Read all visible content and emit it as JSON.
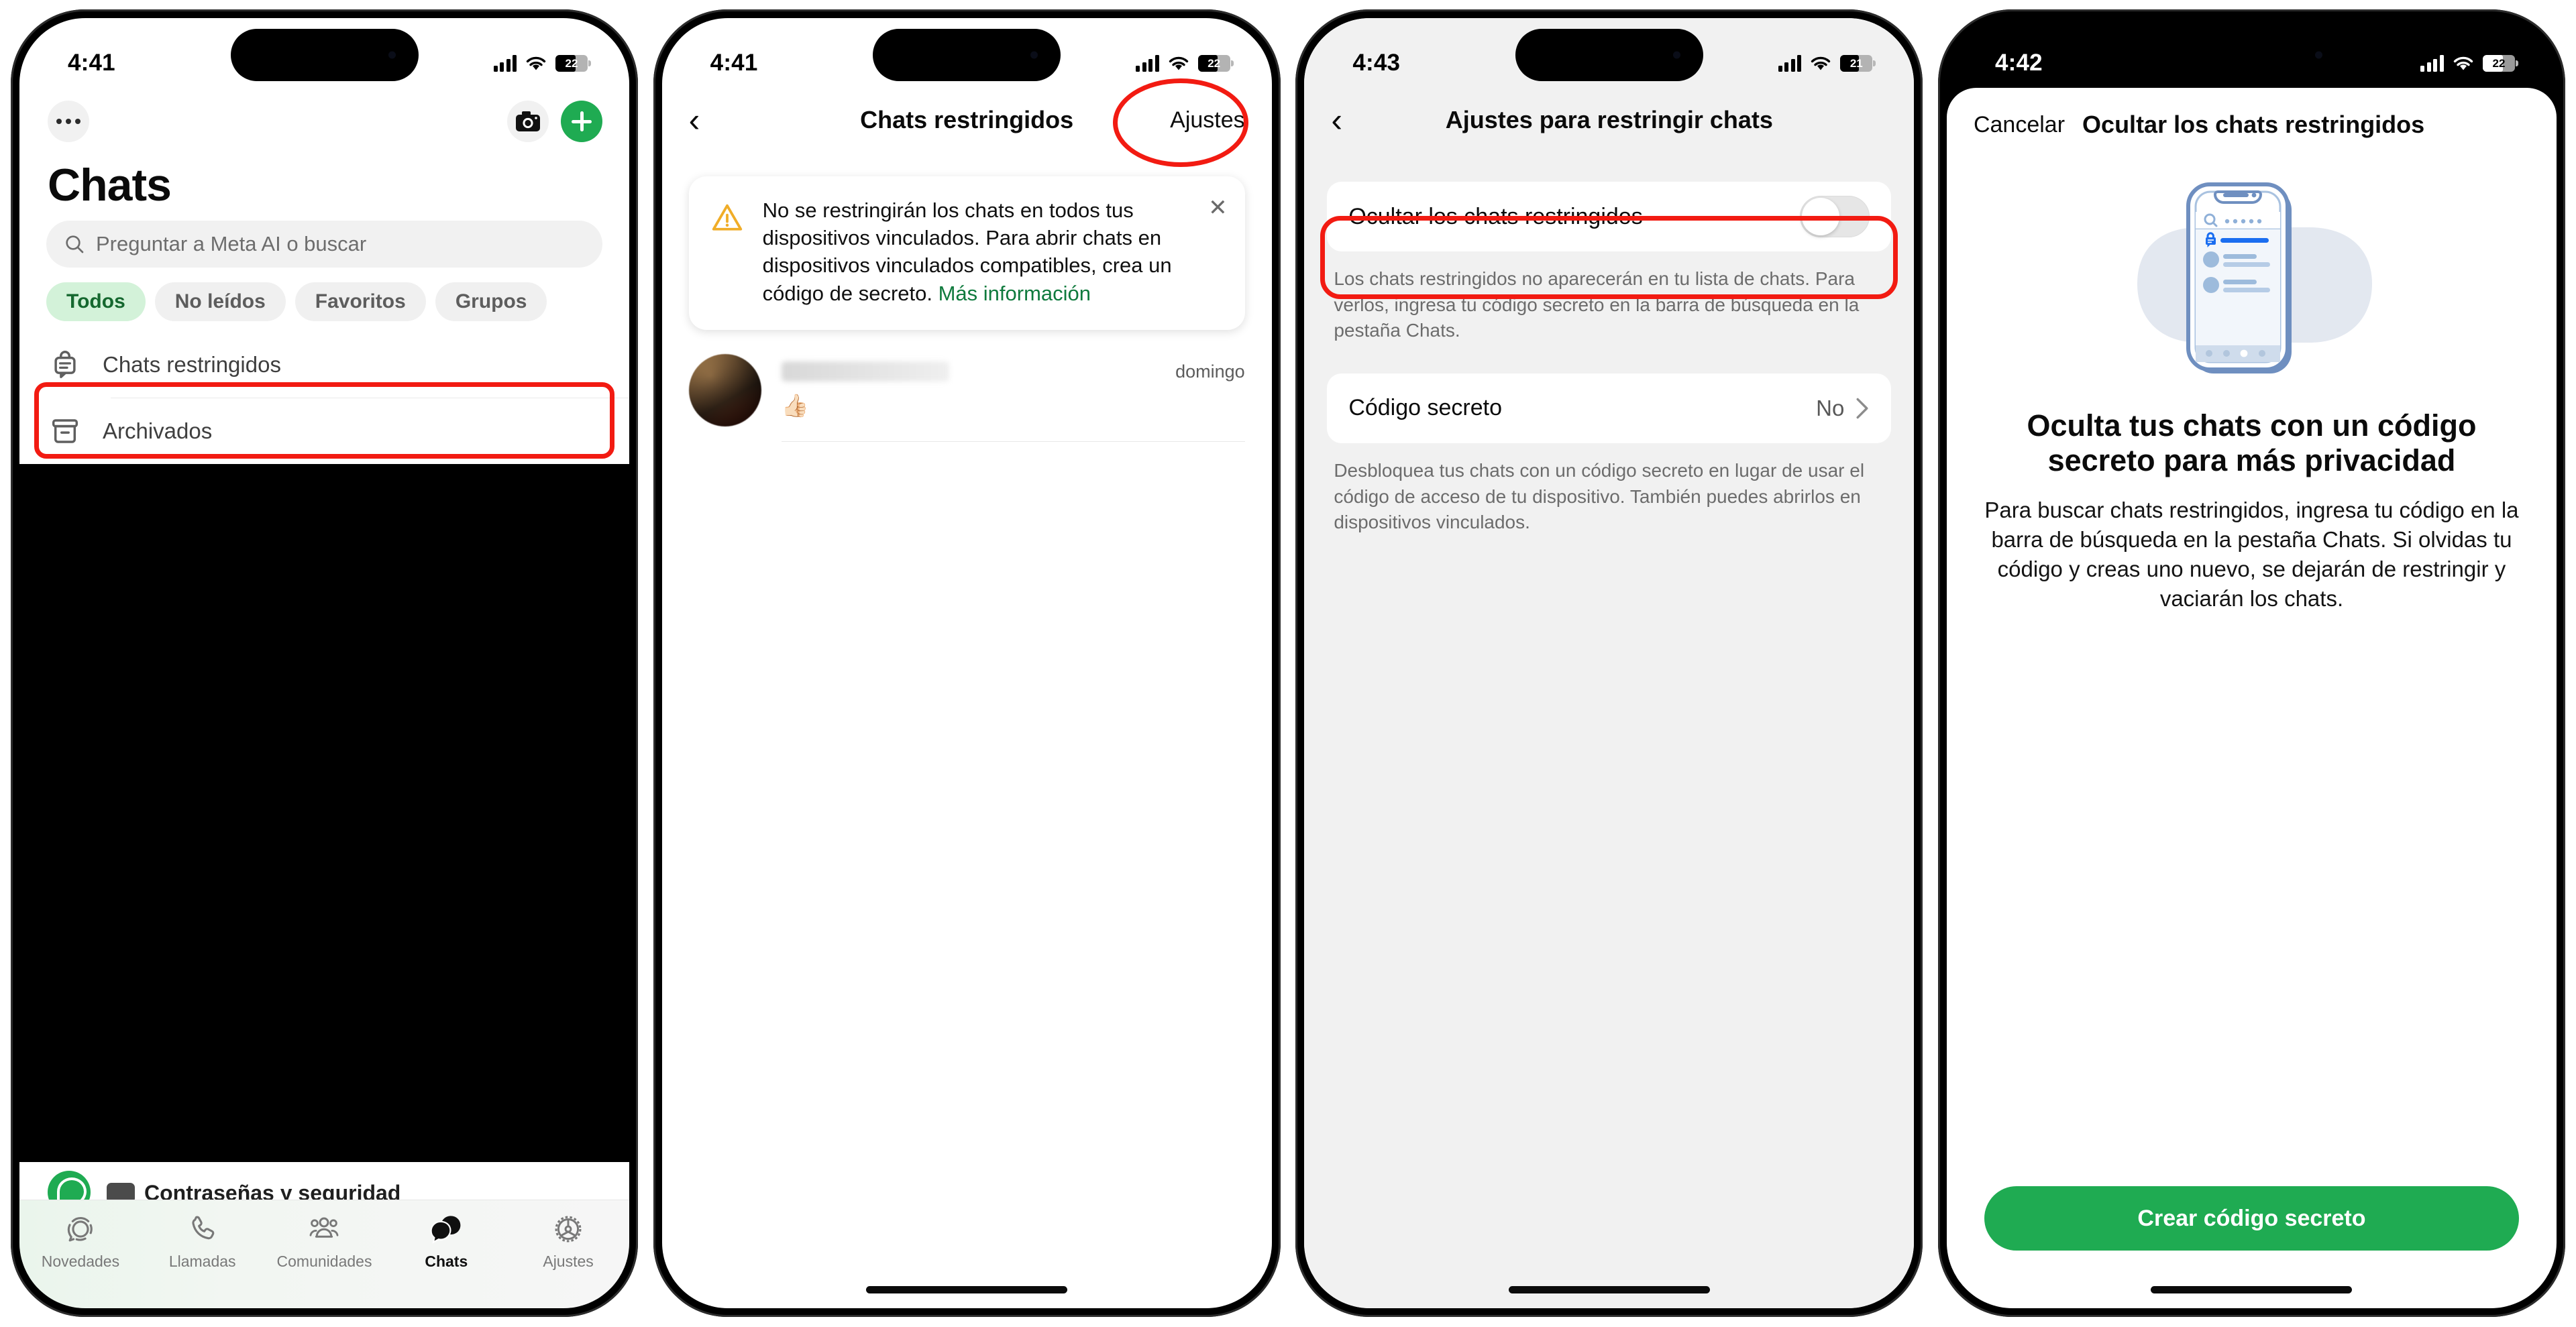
{
  "phones": [
    {
      "status": {
        "time": "4:41",
        "battery": "22"
      },
      "screen": "chats-list",
      "topbar": {
        "menu_icon": "more-dots-icon",
        "camera_icon": "camera-icon",
        "new_chat_icon": "plus-icon"
      },
      "page_title": "Chats",
      "search": {
        "placeholder": "Preguntar a Meta AI o buscar",
        "icon": "search-icon"
      },
      "filters": [
        {
          "label": "Todos",
          "active": true
        },
        {
          "label": "No leídos",
          "active": false
        },
        {
          "label": "Favoritos",
          "active": false
        },
        {
          "label": "Grupos",
          "active": false
        }
      ],
      "rows": [
        {
          "label": "Chats restringidos",
          "icon": "locked-chat-icon",
          "highlighted": true
        },
        {
          "label": "Archivados",
          "icon": "archive-box-icon",
          "highlighted": false
        }
      ],
      "partial_row": {
        "text": "Contraseñas y seguridad",
        "icon": "whatsapp-avatar-icon"
      },
      "tabs": [
        {
          "label": "Novedades",
          "icon": "status-ring-icon",
          "active": false
        },
        {
          "label": "Llamadas",
          "icon": "phone-icon",
          "active": false
        },
        {
          "label": "Comunidades",
          "icon": "communities-icon",
          "active": false
        },
        {
          "label": "Chats",
          "icon": "chat-bubbles-icon",
          "active": true
        },
        {
          "label": "Ajustes",
          "icon": "gear-icon",
          "active": false
        }
      ]
    },
    {
      "status": {
        "time": "4:41",
        "battery": "22"
      },
      "screen": "locked-chats",
      "nav": {
        "back_icon": "chevron-left-icon",
        "title": "Chats restringidos",
        "action": "Ajustes"
      },
      "alert": {
        "icon": "warning-triangle-icon",
        "text": "No se restringirán los chats en todos tus dispositivos vinculados. Para abrir chats en dispositivos vinculados compatibles, crea un código de secreto. ",
        "link": "Más información",
        "close_icon": "close-icon"
      },
      "chat": {
        "name_redacted": true,
        "emoji": "👍🏻",
        "time": "domingo",
        "avatar": "contact-avatar"
      }
    },
    {
      "status": {
        "time": "4:43",
        "battery": "21"
      },
      "screen": "locked-chats-settings",
      "nav": {
        "back_icon": "chevron-left-icon",
        "title": "Ajustes para restringir chats"
      },
      "toggle_row": {
        "label": "Ocultar los chats restringidos",
        "value": "off",
        "highlighted": true
      },
      "toggle_note": "Los chats restringidos no aparecerán en tu lista de chats. Para verlos, ingresa tu código secreto en la barra de búsqueda en la pestaña Chats.",
      "secret_row": {
        "label": "Código secreto",
        "value": "No",
        "chevron": "chevron-right-icon"
      },
      "secret_note": "Desbloquea tus chats con un código secreto en lugar de usar el código de acceso de tu dispositivo. También puedes abrirlos en dispositivos vinculados."
    },
    {
      "status": {
        "time": "4:42",
        "battery": "22"
      },
      "screen": "hide-locked-chats-sheet",
      "sheet": {
        "cancel": "Cancelar",
        "title": "Ocultar los chats restringidos",
        "illustration": "phone-locked-chat-illustration",
        "heading": "Oculta tus chats con un código secreto para más privacidad",
        "paragraph": "Para buscar chats restringidos, ingresa tu código en la barra de búsqueda en la pestaña Chats. Si olvidas tu código y creas uno nuevo, se dejarán de restringir y vaciarán los chats.",
        "cta": "Crear código secreto"
      }
    }
  ],
  "colors": {
    "brand_green": "#1fab52",
    "link_green": "#0f7a3d",
    "chip_active_bg": "#d3f2d9",
    "chip_active_text": "#15682f",
    "highlight_red": "#f21b12",
    "gray_bg": "#f1f1f1"
  }
}
